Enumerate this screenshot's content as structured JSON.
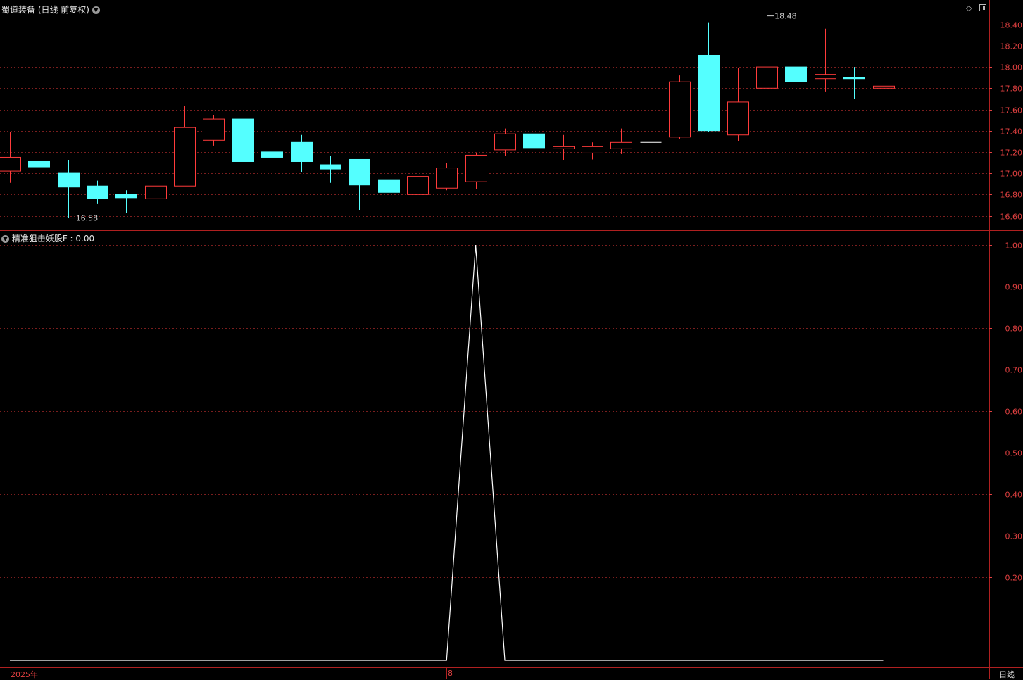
{
  "main_title": "蜀道装备 (日线 前复权)",
  "indicator_title": "精准狙击妖股F : 0.00",
  "period_label": "日线",
  "date_labels": [
    "2025年",
    "8"
  ],
  "colors": {
    "up": "#ff3b3b",
    "down": "#54ffff",
    "flat": "#ffffff",
    "line": "#ffffff",
    "grid": "#7a1e1e",
    "axis": "#e04040"
  },
  "icons": {
    "collapse": "chevron-down-icon",
    "diamond": "diamond-icon",
    "panel": "panel-toggle-icon"
  },
  "chart_data": [
    {
      "type": "candlestick",
      "ylim": [
        16.5,
        18.55
      ],
      "yticks": [
        16.6,
        16.8,
        17.0,
        17.2,
        17.4,
        17.6,
        17.8,
        18.0,
        18.2,
        18.4
      ],
      "annotations": [
        {
          "label": "16.58",
          "index": 2,
          "value": 16.58
        },
        {
          "label": "18.48",
          "index": 26,
          "value": 18.48
        }
      ],
      "candles": [
        {
          "o": 17.02,
          "h": 17.39,
          "l": 16.91,
          "c": 17.15
        },
        {
          "o": 17.11,
          "h": 17.21,
          "l": 16.99,
          "c": 17.06
        },
        {
          "o": 17.0,
          "h": 17.12,
          "l": 16.58,
          "c": 16.87
        },
        {
          "o": 16.88,
          "h": 16.93,
          "l": 16.71,
          "c": 16.76
        },
        {
          "o": 16.8,
          "h": 16.84,
          "l": 16.63,
          "c": 16.77
        },
        {
          "o": 16.76,
          "h": 16.93,
          "l": 16.7,
          "c": 16.88
        },
        {
          "o": 16.88,
          "h": 17.63,
          "l": 16.88,
          "c": 17.43
        },
        {
          "o": 17.31,
          "h": 17.55,
          "l": 17.26,
          "c": 17.51
        },
        {
          "o": 17.51,
          "h": 17.51,
          "l": 17.11,
          "c": 17.11
        },
        {
          "o": 17.2,
          "h": 17.26,
          "l": 17.1,
          "c": 17.15
        },
        {
          "o": 17.29,
          "h": 17.36,
          "l": 17.01,
          "c": 17.11
        },
        {
          "o": 17.08,
          "h": 17.16,
          "l": 16.91,
          "c": 17.04
        },
        {
          "o": 17.13,
          "h": 17.13,
          "l": 16.65,
          "c": 16.89
        },
        {
          "o": 16.94,
          "h": 17.1,
          "l": 16.65,
          "c": 16.82
        },
        {
          "o": 16.8,
          "h": 17.49,
          "l": 16.72,
          "c": 16.97
        },
        {
          "o": 16.86,
          "h": 17.1,
          "l": 16.84,
          "c": 17.05
        },
        {
          "o": 16.92,
          "h": 17.19,
          "l": 16.85,
          "c": 17.17
        },
        {
          "o": 17.22,
          "h": 17.42,
          "l": 17.16,
          "c": 17.37
        },
        {
          "o": 17.37,
          "h": 17.39,
          "l": 17.19,
          "c": 17.24
        },
        {
          "o": 17.23,
          "h": 17.36,
          "l": 17.12,
          "c": 17.25
        },
        {
          "o": 17.19,
          "h": 17.29,
          "l": 17.13,
          "c": 17.25
        },
        {
          "o": 17.23,
          "h": 17.42,
          "l": 17.18,
          "c": 17.29
        },
        {
          "o": 17.29,
          "h": 17.3,
          "l": 17.04,
          "c": 17.29
        },
        {
          "o": 17.34,
          "h": 17.92,
          "l": 17.32,
          "c": 17.86
        },
        {
          "o": 18.11,
          "h": 18.42,
          "l": 17.39,
          "c": 17.4
        },
        {
          "o": 17.36,
          "h": 17.99,
          "l": 17.3,
          "c": 17.67
        },
        {
          "o": 17.8,
          "h": 18.48,
          "l": 17.8,
          "c": 18.0
        },
        {
          "o": 18.0,
          "h": 18.13,
          "l": 17.7,
          "c": 17.86
        },
        {
          "o": 17.89,
          "h": 18.36,
          "l": 17.77,
          "c": 17.93
        },
        {
          "o": 17.9,
          "h": 18.0,
          "l": 17.7,
          "c": 17.89
        },
        {
          "o": 17.8,
          "h": 18.21,
          "l": 17.74,
          "c": 17.82
        }
      ]
    },
    {
      "type": "line",
      "ylim": [
        0.0,
        1.03
      ],
      "yticks": [
        0.2,
        0.3,
        0.4,
        0.5,
        0.6,
        0.7,
        0.8,
        0.9,
        1.0
      ],
      "series": [
        {
          "values": [
            0,
            0,
            0,
            0,
            0,
            0,
            0,
            0,
            0,
            0,
            0,
            0,
            0,
            0,
            0,
            0,
            1,
            0,
            0,
            0,
            0,
            0,
            0,
            0,
            0,
            0,
            0,
            0,
            0,
            0,
            0
          ]
        }
      ]
    }
  ]
}
